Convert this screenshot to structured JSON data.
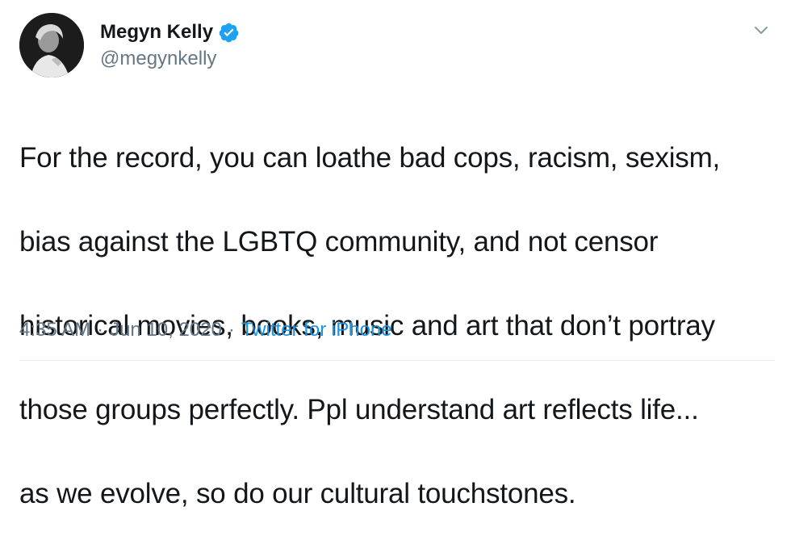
{
  "author": {
    "display_name": "Megyn Kelly",
    "handle": "@megynkelly",
    "verified": true
  },
  "tweet": {
    "text_lines": [
      "For the record, you can loathe bad cops, racism, sexism,",
      "bias against the LGBTQ community, and not censor",
      "historical movies, books, music and art that don’t portray",
      "those groups perfectly. Ppl understand art reflects life...",
      "as we evolve, so do our cultural touchstones."
    ],
    "time": "4:35 AM",
    "date": "Jun 10, 2020",
    "separator": "·",
    "source": "Twitter for iPhone"
  },
  "icons": {
    "verified": "verified-badge-icon",
    "more": "chevron-down-icon",
    "avatar": "profile-photo"
  },
  "colors": {
    "text": "#14171a",
    "secondary": "#657786",
    "link": "#1b95e0",
    "verified": "#1da1f2",
    "divider": "#e6ecf0"
  }
}
